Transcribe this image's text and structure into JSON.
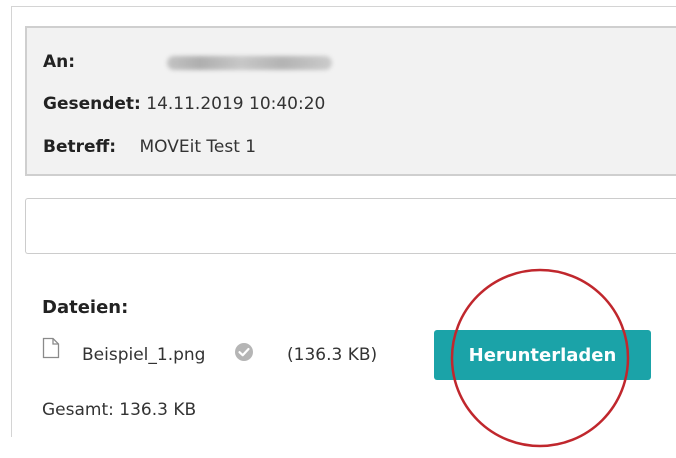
{
  "email_header": {
    "to_label": "An:",
    "to_value": "",
    "sent_label": "Gesendet:",
    "sent_value": "14.11.2019 10:40:20",
    "subject_label": "Betreff:",
    "subject_value": "MOVEit Test 1"
  },
  "message": {
    "value": ""
  },
  "files": {
    "title": "Dateien:",
    "items": [
      {
        "name": "Beispiel_1.png",
        "size": "(136.3 KB)",
        "icon": "file-icon",
        "status_icon": "verified-check-icon"
      }
    ],
    "download_label": "Herunterladen",
    "total": "Gesamt: 136.3 KB"
  },
  "colors": {
    "button": "#1ba3a8",
    "annotation_circle": "#c0272d",
    "header_bg": "#f2f2f2"
  }
}
